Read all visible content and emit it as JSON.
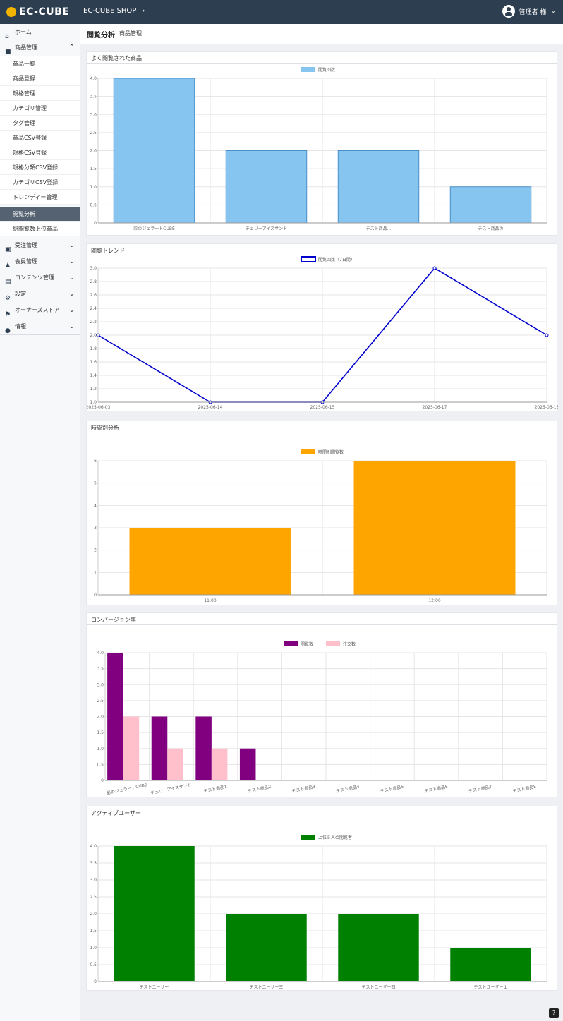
{
  "header": {
    "brand": "EC-CUBE",
    "shop_name": "EC-CUBE SHOP",
    "user": "管理者 様"
  },
  "sidebar": {
    "items": [
      {
        "label": "ホーム",
        "icon": "home-icon"
      },
      {
        "label": "商品管理",
        "icon": "box-icon"
      },
      {
        "label": "受注管理",
        "icon": "cart-icon"
      },
      {
        "label": "会員管理",
        "icon": "users-icon"
      },
      {
        "label": "コンテンツ管理",
        "icon": "file-icon"
      },
      {
        "label": "設定",
        "icon": "gear-icon"
      },
      {
        "label": "オーナーズストア",
        "icon": "plug-icon"
      },
      {
        "label": "情報",
        "icon": "info-icon"
      }
    ],
    "sub_items": [
      "商品一覧",
      "商品登録",
      "規格管理",
      "カテゴリ管理",
      "タグ管理",
      "商品CSV登録",
      "規格CSV登録",
      "規格分類CSV登録",
      "カテゴリCSV登録",
      "トレンディー管理",
      "閲覧分析",
      "総閲覧数上位商品"
    ]
  },
  "page": {
    "title": "閲覧分析",
    "subtitle": "商品管理"
  },
  "panels": [
    "よく閲覧された商品",
    "閲覧トレンド",
    "時間別分析",
    "コンバージョン率",
    "アクティブユーザー"
  ],
  "chart_data": [
    {
      "type": "bar",
      "title": "よく閲覧された商品",
      "categories": [
        "彩のジェラートCUBE",
        "チェリーアイスサンド",
        "テスト商品...",
        "テスト商品の"
      ],
      "series": [
        {
          "name": "閲覧回数",
          "values": [
            4,
            2,
            2,
            1
          ],
          "color": "#86c5f0"
        }
      ],
      "ylim": [
        0,
        4
      ],
      "yticks": [
        "0",
        "0.5",
        "1.0",
        "1.5",
        "2.0",
        "2.5",
        "3.0",
        "3.5",
        "4.0"
      ],
      "grid": true,
      "legend": "top"
    },
    {
      "type": "line",
      "title": "閲覧トレンド",
      "categories": [
        "2025-06-03",
        "2025-06-14",
        "2025-06-15",
        "2025-06-17",
        "2025-06-18"
      ],
      "series": [
        {
          "name": "閲覧回数（7日間）",
          "values": [
            2,
            1,
            1,
            3,
            2
          ],
          "color": "#0000cc"
        }
      ],
      "ylim": [
        1,
        3
      ],
      "yticks": [
        "1.0",
        "1.2",
        "1.4",
        "1.6",
        "1.8",
        "2.0",
        "2.2",
        "2.4",
        "2.6",
        "2.8",
        "3.0"
      ],
      "grid": true,
      "legend": "top"
    },
    {
      "type": "bar",
      "title": "時間別分析",
      "categories": [
        "11:00",
        "12:00"
      ],
      "series": [
        {
          "name": "時間別閲覧数",
          "values": [
            3,
            6
          ],
          "color": "#ffa500"
        }
      ],
      "ylim": [
        0,
        6
      ],
      "yticks": [
        "0",
        "1",
        "2",
        "3",
        "4",
        "5",
        "6"
      ],
      "grid": true,
      "legend": "top"
    },
    {
      "type": "bar",
      "title": "コンバージョン率",
      "categories": [
        "彩のジェラートCUBE",
        "チェリーアイスサンド",
        "テスト商品1",
        "テスト商品2",
        "テスト商品3",
        "テスト商品4",
        "テスト商品5",
        "テスト商品6",
        "テスト商品7",
        "テスト商品8"
      ],
      "series": [
        {
          "name": "閲覧数",
          "values": [
            4,
            2,
            2,
            1,
            0,
            0,
            0,
            0,
            0,
            0
          ],
          "color": "#800080"
        },
        {
          "name": "注文数",
          "values": [
            2,
            1,
            1,
            0,
            0,
            0,
            0,
            0,
            0,
            0
          ],
          "color": "#ffc0cb"
        }
      ],
      "ylim": [
        0,
        4
      ],
      "yticks": [
        "0",
        "0.5",
        "1.0",
        "1.5",
        "2.0",
        "2.5",
        "3.0",
        "3.5",
        "4.0"
      ],
      "grid": true,
      "legend": "top"
    },
    {
      "type": "bar",
      "title": "アクティブユーザー",
      "categories": [
        "テストユーザー",
        "テストユーザー三",
        "テストユーザー四",
        "テストユーザー１"
      ],
      "series": [
        {
          "name": "上位５人の閲覧者",
          "values": [
            4,
            2,
            2,
            1
          ],
          "color": "#008000"
        }
      ],
      "ylim": [
        0,
        4
      ],
      "yticks": [
        "0",
        "0.5",
        "1.0",
        "1.5",
        "2.0",
        "2.5",
        "3.0",
        "3.5",
        "4.0"
      ],
      "grid": true,
      "legend": "top"
    }
  ]
}
